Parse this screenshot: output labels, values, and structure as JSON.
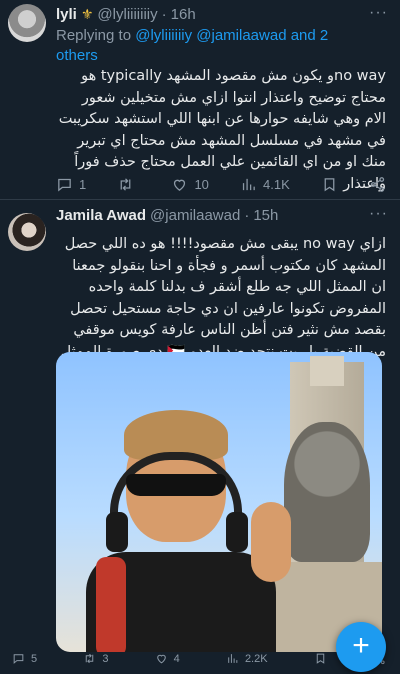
{
  "tweet1": {
    "name": "lyli",
    "handle": "@lyliiiiiiiy",
    "dot": "·",
    "time": "16h",
    "replying_prefix": "Replying to ",
    "replying_mentions": "@lyliiiiiiy @jamilaawad",
    "replying_suffix": " and 2 others",
    "body": "no wayو يكون مش مقصود المشهد typically هو محتاج توضيح واعتذار انتوا ازاي مش متخيلين شعور الام وهي شايفه حوارها عن ابنها اللي استشهد سكريبت في مشهد في مسلسل المشهد مش محتاج اي تبرير منك او من اي القائمين علي العمل محتاج حذف فوراً واعتذار",
    "actions": {
      "reply": "1",
      "retweet": "",
      "like": "10",
      "views": "4.1K"
    }
  },
  "tweet2": {
    "name": "Jamila Awad",
    "handle": "@jamilaawad",
    "dot": "·",
    "time": "15h",
    "body": "ازاي no way يبقى مش مقصود!!!! هو ده اللي حصل المشهد كان مكتوب أسمر و فجأة و احنا بنقولو جمعنا ان الممثل اللي جه طلع أشقر ف بدلنا كلمة واحده  المفروض تكونوا عارفين ان دي حاجة مستحيل تحصل بقصد مش نثير فتن أظن الناس عارفة كويس موقفي من القضية يا ريت نتحد ضد العدو 🇵🇸 دي صورة الممثل",
    "actions": {
      "reply": "5",
      "retweet": "3",
      "like": "4",
      "views": "2.2K"
    }
  },
  "fab_label": "+"
}
